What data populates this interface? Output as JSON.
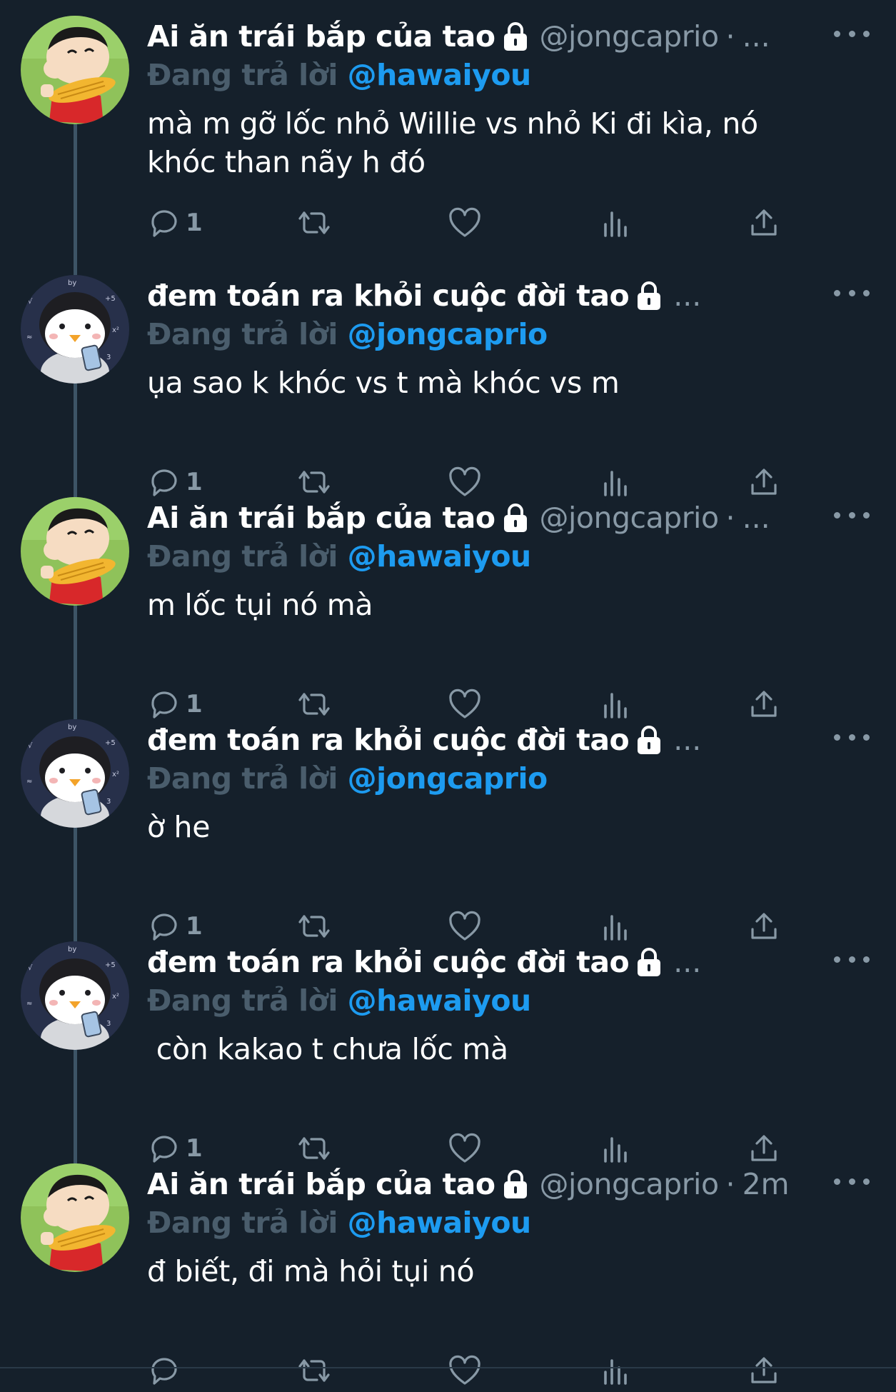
{
  "colors": {
    "background": "#15202b",
    "primary_text": "#ffffff",
    "secondary_text": "#8899a6",
    "reply_prefix": "#4a5d6c",
    "link": "#1d9bf0",
    "thread_line": "#3d5466"
  },
  "tweets": [
    {
      "avatar": "shinchan-avatar",
      "display_name": "Ai ăn trái bắp của tao",
      "handle": "@jongcaprio",
      "separator": "·",
      "time": "",
      "ellipsis": "...",
      "reply_prefix": "Đang trả lời",
      "reply_to": "@hawaiyou",
      "text_lines": [
        "mà m gỡ lốc nhỏ Willie vs nhỏ Ki đi kìa, nó",
        "khóc than nãy h đó"
      ],
      "reply_count": "1"
    },
    {
      "avatar": "penguin-avatar",
      "display_name": "đem toán ra khỏi cuộc đời tao",
      "handle": "",
      "separator": "",
      "time": "",
      "ellipsis": "...",
      "reply_prefix": "Đang trả lời",
      "reply_to": "@jongcaprio",
      "text_lines": [
        "ụa sao k khóc vs t mà khóc vs m"
      ],
      "reply_count": "1"
    },
    {
      "avatar": "shinchan-avatar",
      "display_name": "Ai ăn trái bắp của tao",
      "handle": "@jongcaprio",
      "separator": "·",
      "time": "",
      "ellipsis": "...",
      "reply_prefix": "Đang trả lời",
      "reply_to": "@hawaiyou",
      "text_lines": [
        "m lốc tụi nó mà"
      ],
      "reply_count": "1"
    },
    {
      "avatar": "penguin-avatar",
      "display_name": "đem toán ra khỏi cuộc đời tao",
      "handle": "",
      "separator": "",
      "time": "",
      "ellipsis": "...",
      "reply_prefix": "Đang trả lời",
      "reply_to": "@jongcaprio",
      "text_lines": [
        "ờ he"
      ],
      "reply_count": "1"
    },
    {
      "avatar": "penguin-avatar",
      "display_name": "đem toán ra khỏi cuộc đời tao",
      "handle": "",
      "separator": "",
      "time": "",
      "ellipsis": "...",
      "reply_prefix": "Đang trả lời",
      "reply_to": "@hawaiyou",
      "text_lines": [
        " còn kakao t chưa lốc mà"
      ],
      "reply_count": "1"
    },
    {
      "avatar": "shinchan-avatar",
      "display_name": "Ai ăn trái bắp của tao",
      "handle": "@jongcaprio",
      "separator": "·",
      "time": "2m",
      "ellipsis": "",
      "reply_prefix": "Đang trả lời",
      "reply_to": "@hawaiyou",
      "text_lines": [
        "đ biết, đi mà hỏi tụi nó"
      ],
      "reply_count": ""
    }
  ]
}
